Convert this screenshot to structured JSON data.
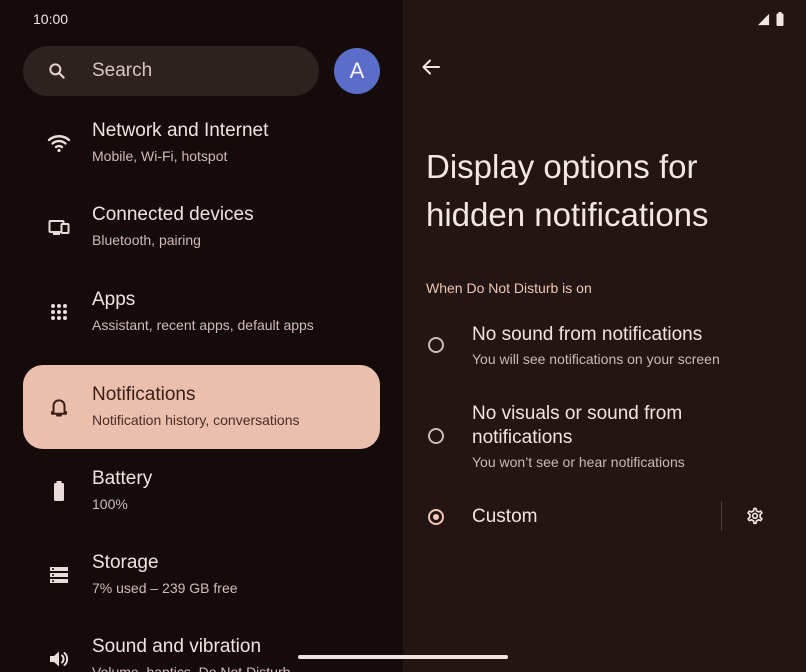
{
  "status_bar": {
    "time": "10:00"
  },
  "search": {
    "label": "Search"
  },
  "account": {
    "initial": "A"
  },
  "settings_list": [
    {
      "title": "Network and Internet",
      "subtitle": "Mobile, Wi-Fi, hotspot",
      "icon": "wifi-icon"
    },
    {
      "title": "Connected devices",
      "subtitle": "Bluetooth, pairing",
      "icon": "devices-icon"
    },
    {
      "title": "Apps",
      "subtitle": "Assistant, recent apps, default apps",
      "icon": "apps-grid-icon"
    },
    {
      "title": "Notifications",
      "subtitle": "Notification history, conversations",
      "icon": "bell-icon",
      "selected": true
    },
    {
      "title": "Battery",
      "subtitle": "100%",
      "icon": "battery-icon"
    },
    {
      "title": "Storage",
      "subtitle": "7% used – 239 GB free",
      "icon": "storage-icon"
    },
    {
      "title": "Sound and vibration",
      "subtitle": "Volume, haptics, Do Not Disturb",
      "icon": "volume-icon"
    }
  ],
  "detail": {
    "title": "Display options for hidden notifications",
    "section_header": "When Do Not Disturb is on",
    "options": [
      {
        "title": "No sound from notifications",
        "subtitle": "You will see notifications on your screen",
        "checked": false
      },
      {
        "title": "No visuals or sound from notifications",
        "subtitle": "You won’t see or hear notifications",
        "checked": false
      },
      {
        "title": "Custom",
        "subtitle": "",
        "checked": true
      }
    ]
  },
  "colors": {
    "background": "#150b0a",
    "detail_background": "#221513",
    "selected_item": "#ebbfae",
    "accent": "#f2c9b8",
    "avatar": "#5a6ec9"
  }
}
